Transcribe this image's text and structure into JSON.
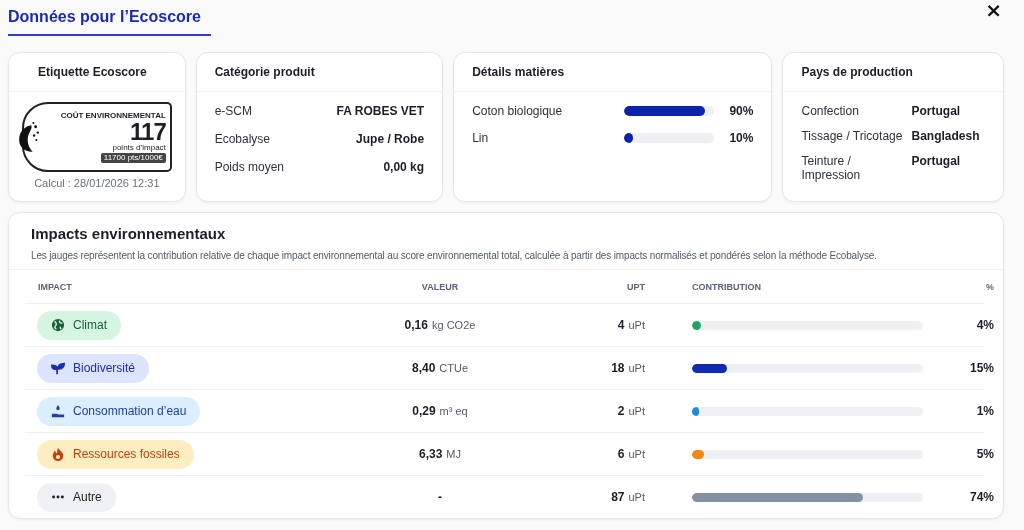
{
  "title": "Données pour l’Ecoscore",
  "close": "×",
  "label_card": {
    "title": "Etiquette Ecoscore",
    "label": {
      "heading": "COÛT ENVIRONNEMENTAL",
      "score": "117",
      "unit": "points d’impact",
      "ratio": "11700 pts/1000€"
    },
    "computed": "Calcul : 28/01/2026 12:31"
  },
  "category_card": {
    "title": "Catégorie produit",
    "rows": [
      {
        "label": "e-SCM",
        "value": "FA ROBES VET"
      },
      {
        "label": "Ecobalyse",
        "value": "Jupe / Robe"
      },
      {
        "label": "Poids moyen",
        "value": "0,00 kg"
      }
    ]
  },
  "materials_card": {
    "title": "Détails matières",
    "rows": [
      {
        "label": "Coton biologique",
        "level": 0.9,
        "percent": "90%"
      },
      {
        "label": "Lin",
        "level": 0.1,
        "percent": "10%"
      }
    ]
  },
  "countries_card": {
    "title": "Pays de production",
    "rows": [
      {
        "label": "Confection",
        "value": "Portugal"
      },
      {
        "label": "Tissage / Tricotage",
        "value": "Bangladesh"
      },
      {
        "label": "Teinture / Impression",
        "value": "Portugal"
      }
    ]
  },
  "impacts": {
    "title": "Impacts environnementaux",
    "description": "Les jauges représentent la contribution relative de chaque impact environnemental au score environnemental total, calculée à partir des impacts normalisés et pondérés selon la méthode Ecobalyse.",
    "columns": [
      "IMPACT",
      "VALEUR",
      "UPT",
      "CONTRIBUTION",
      "%"
    ],
    "rows": [
      {
        "kind": "climate",
        "name": "Climat",
        "value": "0,16",
        "unit": "kg CO2e",
        "upt": "4",
        "upt_unit": "uPt",
        "level": 0.04,
        "color": "#1fa463",
        "percent": "4%"
      },
      {
        "kind": "biodiversity",
        "name": "Biodiversité",
        "value": "8,40",
        "unit": "CTUe",
        "upt": "18",
        "upt_unit": "uPt",
        "level": 0.15,
        "color": "#0f2bb0",
        "percent": "15%"
      },
      {
        "kind": "water",
        "name": "Consommation d’eau",
        "value": "0,29",
        "unit": "m³ eq",
        "upt": "2",
        "upt_unit": "uPt",
        "level": 0.01,
        "color": "#1e88e5",
        "percent": "1%"
      },
      {
        "kind": "fossil",
        "name": "Ressources fossiles",
        "value": "6,33",
        "unit": "MJ",
        "upt": "6",
        "upt_unit": "uPt",
        "level": 0.05,
        "color": "#ef8a0a",
        "percent": "5%"
      },
      {
        "kind": "other",
        "name": "Autre",
        "value": "-",
        "upt": "87",
        "upt_unit": "uPt",
        "level": 0.74,
        "color": "#8590a2",
        "percent": "74%"
      }
    ]
  }
}
